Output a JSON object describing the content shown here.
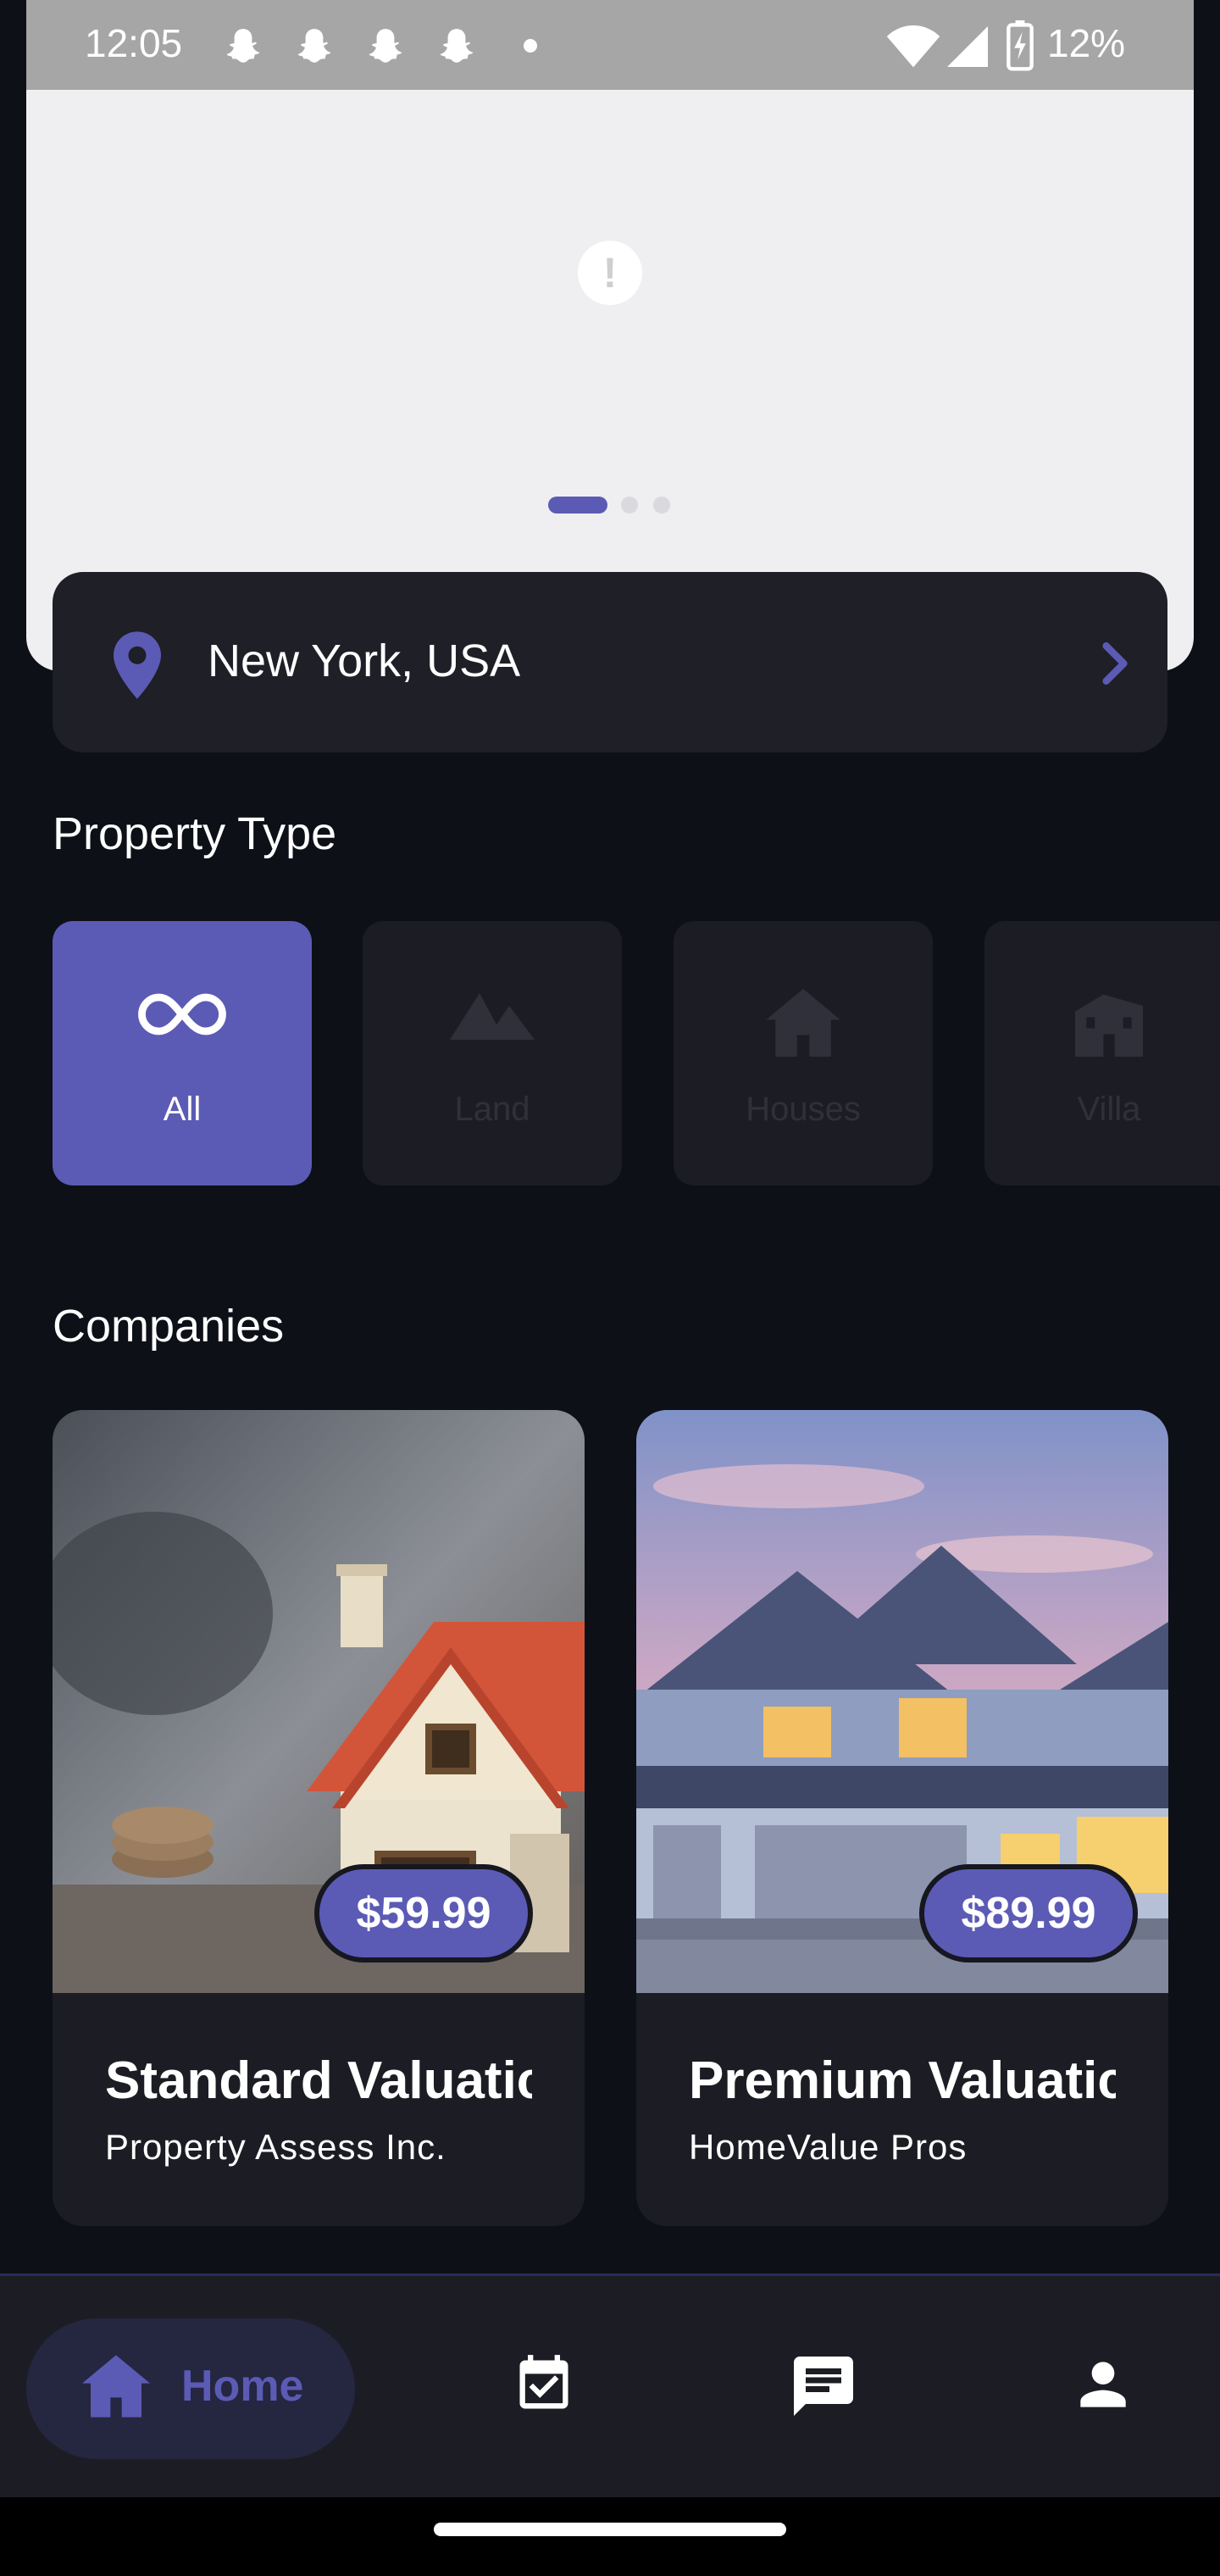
{
  "status_bar": {
    "time": "12:05",
    "battery": "12%",
    "notification_icons": [
      "snapchat-icon",
      "snapchat-icon",
      "snapchat-icon",
      "snapchat-icon"
    ]
  },
  "banner": {
    "status_icon": "alert-icon",
    "page_count": 3,
    "active_page": 1
  },
  "location": {
    "text": "New York, USA",
    "icon": "location-pin-icon",
    "chevron": "chevron-right-icon"
  },
  "property_section": {
    "title": "Property Type",
    "types": [
      {
        "label": "All",
        "icon": "infinity-icon",
        "active": true
      },
      {
        "label": "Land",
        "icon": "landscape-icon",
        "active": false
      },
      {
        "label": "Houses",
        "icon": "house-icon",
        "active": false
      },
      {
        "label": "Villa",
        "icon": "villa-icon",
        "active": false
      }
    ]
  },
  "companies_section": {
    "title": "Companies",
    "items": [
      {
        "name": "Standard Valuatic",
        "company": "Property Assess Inc.",
        "price": "$59.99"
      },
      {
        "name": "Premium Valuatic",
        "company": "HomeValue Pros",
        "price": "$89.99"
      }
    ]
  },
  "bottom_nav": {
    "home_label": "Home",
    "items": [
      "home-icon",
      "calendar-check-icon",
      "chat-icon",
      "person-icon"
    ]
  },
  "colors": {
    "accent": "#5b5bb5",
    "background": "#0d1017",
    "card": "#1c1d24"
  }
}
